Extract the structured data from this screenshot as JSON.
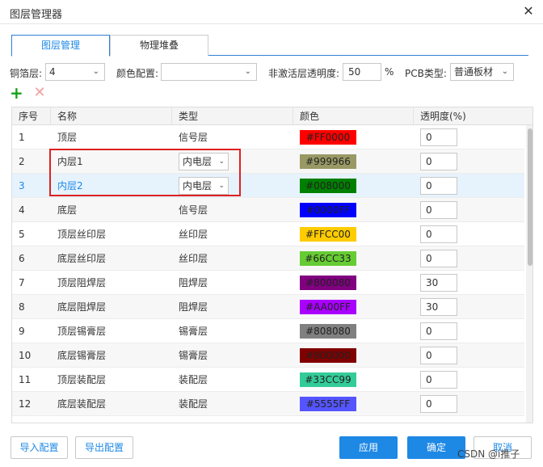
{
  "window": {
    "title": "图层管理器"
  },
  "tabs": [
    {
      "label": "图层管理",
      "active": true
    },
    {
      "label": "物理堆叠",
      "active": false
    }
  ],
  "toolbar": {
    "copper_label": "铜箔层:",
    "copper_value": "4",
    "color_config_label": "颜色配置:",
    "color_config_value": "",
    "inactive_opacity_label": "非激活层透明度:",
    "inactive_opacity_value": "50",
    "percent_sign": "%",
    "pcb_type_label": "PCB类型:",
    "pcb_type_value": "普通板材"
  },
  "table": {
    "columns": [
      "序号",
      "名称",
      "类型",
      "颜色",
      "透明度(%)"
    ],
    "rows": [
      {
        "index": "1",
        "name": "顶层",
        "type": "信号层",
        "type_editable": false,
        "color": "#FF0000",
        "opacity": "0"
      },
      {
        "index": "2",
        "name": "内层1",
        "type": "内电层",
        "type_editable": true,
        "color": "#999966",
        "opacity": "0"
      },
      {
        "index": "3",
        "name": "内层2",
        "type": "内电层",
        "type_editable": true,
        "color": "#008000",
        "opacity": "0",
        "selected": true
      },
      {
        "index": "4",
        "name": "底层",
        "type": "信号层",
        "type_editable": false,
        "color": "#0000FF",
        "opacity": "0"
      },
      {
        "index": "5",
        "name": "顶层丝印层",
        "type": "丝印层",
        "type_editable": false,
        "color": "#FFCC00",
        "opacity": "0"
      },
      {
        "index": "6",
        "name": "底层丝印层",
        "type": "丝印层",
        "type_editable": false,
        "color": "#66CC33",
        "opacity": "0"
      },
      {
        "index": "7",
        "name": "顶层阻焊层",
        "type": "阻焊层",
        "type_editable": false,
        "color": "#800080",
        "opacity": "30"
      },
      {
        "index": "8",
        "name": "底层阻焊层",
        "type": "阻焊层",
        "type_editable": false,
        "color": "#AA00FF",
        "opacity": "30"
      },
      {
        "index": "9",
        "name": "顶层锡膏层",
        "type": "锡膏层",
        "type_editable": false,
        "color": "#808080",
        "opacity": "0"
      },
      {
        "index": "10",
        "name": "底层锡膏层",
        "type": "锡膏层",
        "type_editable": false,
        "color": "#800000",
        "opacity": "0"
      },
      {
        "index": "11",
        "name": "顶层装配层",
        "type": "装配层",
        "type_editable": false,
        "color": "#33CC99",
        "opacity": "0"
      },
      {
        "index": "12",
        "name": "底层装配层",
        "type": "装配层",
        "type_editable": false,
        "color": "#5555FF",
        "opacity": "0"
      }
    ]
  },
  "footer": {
    "import_label": "导入配置",
    "export_label": "导出配置",
    "apply_label": "应用",
    "ok_label": "确定",
    "cancel_label": "取消"
  },
  "watermark": "CSDN @i推子",
  "icons": {
    "close": "close-icon",
    "add": "plus-icon",
    "remove": "x-icon",
    "dropdown": "chevron-down-icon"
  },
  "colors": {
    "accent": "#1e88e5",
    "highlight": "#e02020",
    "add": "#17a117",
    "remove": "#f0a0a0"
  }
}
